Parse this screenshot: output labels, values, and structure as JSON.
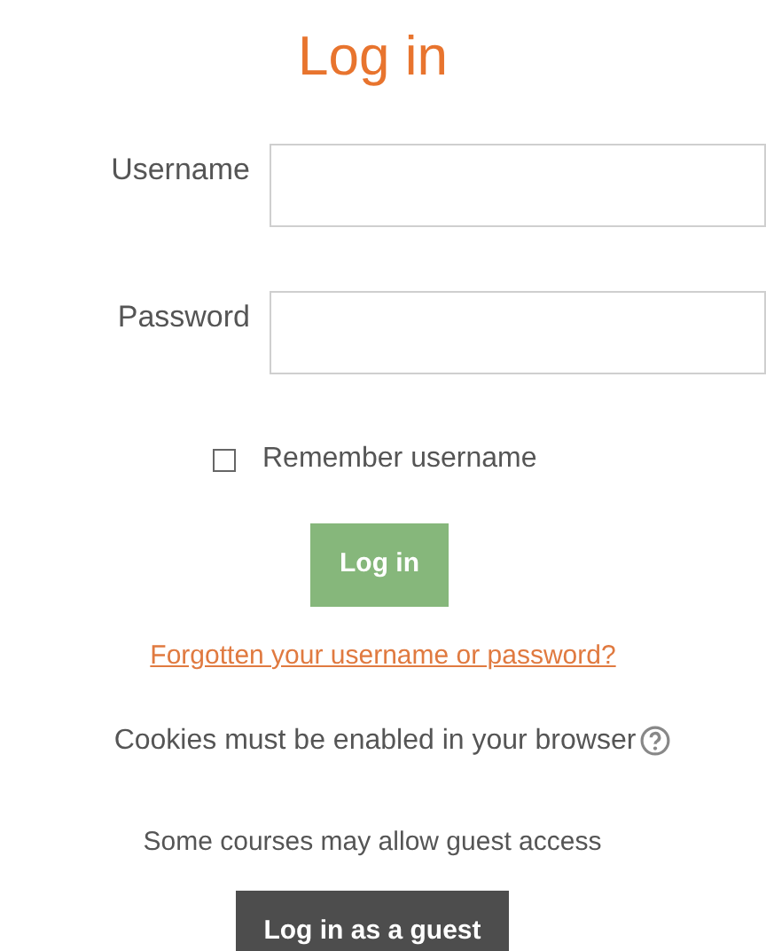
{
  "title": "Log in",
  "username_field": {
    "label": "Username"
  },
  "password_field": {
    "label": "Password"
  },
  "remember": {
    "label": "Remember username",
    "checked": false
  },
  "login_button": "Log in",
  "forgot_link": "Forgotten your username or password?",
  "cookies_note": "Cookies must be enabled in your browser",
  "guest_note": "Some courses may allow guest access",
  "guest_button": "Log in as a guest"
}
